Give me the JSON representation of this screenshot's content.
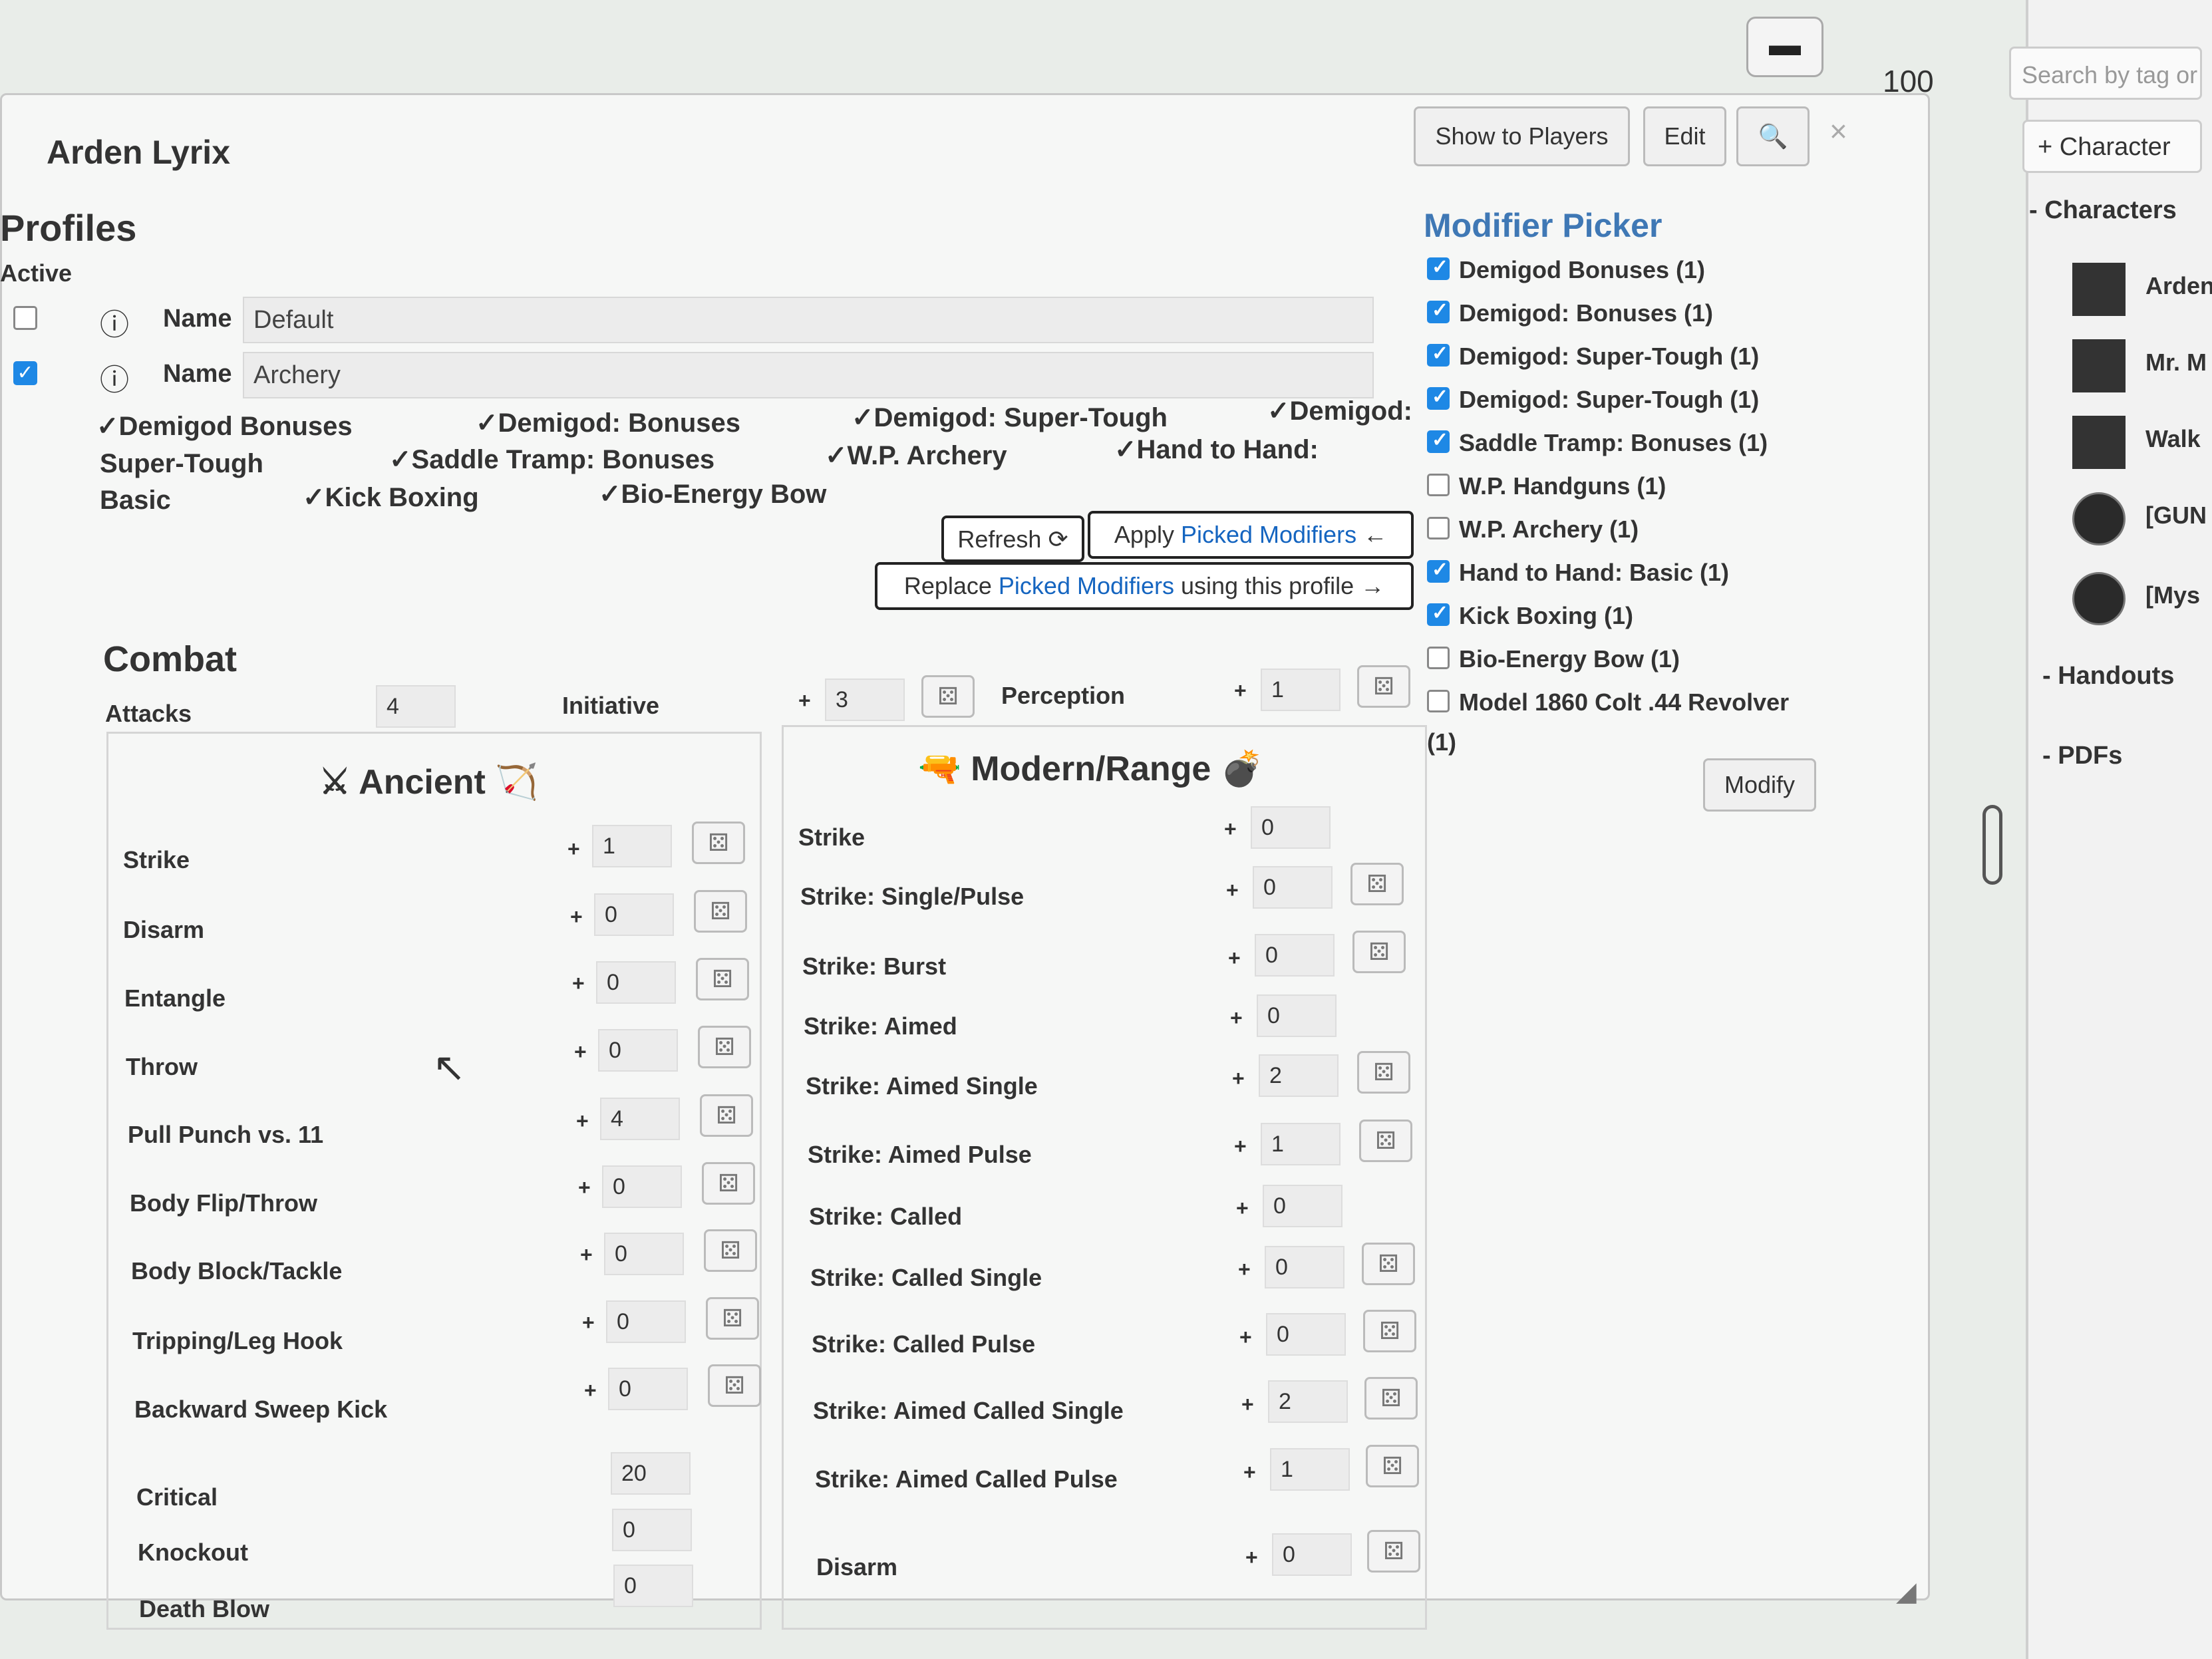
{
  "sidebar": {
    "search_placeholder": "Search by tag or",
    "add_character": "+ Character",
    "folders": {
      "characters": "-  Characters",
      "handouts": "-  Handouts",
      "pdfs": "-  PDFs"
    },
    "roster": [
      "Arden",
      "Mr. M",
      "Walk",
      "[GUN",
      "[Mys"
    ]
  },
  "zoom": {
    "label": "100",
    "plus": "+",
    "minus": "−"
  },
  "dialog": {
    "title": "Arden Lyrix",
    "buttons": {
      "show_to_players": "Show to Players",
      "edit": "Edit",
      "search": "🔍",
      "close": "×"
    }
  },
  "profiles": {
    "heading": "Profiles",
    "active_label": "Active",
    "name_label": "Name",
    "rows": [
      {
        "active": false,
        "name": "Default"
      },
      {
        "active": true,
        "name": "Archery"
      }
    ],
    "applied_modifiers": [
      "✓Demigod Bonuses",
      "✓Demigod: Bonuses",
      "✓Demigod: Super-Tough",
      "✓Demigod:",
      "Super-Tough",
      "✓Saddle Tramp: Bonuses",
      "✓W.P. Archery",
      "✓Hand to Hand:",
      "Basic",
      "✓Kick Boxing",
      "✓Bio-Energy Bow"
    ],
    "refresh_label": "Refresh ⟳",
    "apply_label_prefix": "Apply ",
    "apply_label_hl": "Picked Modifiers",
    "apply_label_suffix": " ←",
    "replace_prefix": "Replace ",
    "replace_hl": "Picked Modifiers",
    "replace_suffix": " using this profile →"
  },
  "combat": {
    "heading": "Combat",
    "attacks_label": "Attacks",
    "attacks_value": "4",
    "initiative_label": "Initiative",
    "initiative_value": "3",
    "perception_label": "Perception",
    "perception_value": "1",
    "plus": "+",
    "roll_icon": "⚄",
    "ancient": {
      "title": "⚔ Ancient 🏹",
      "rows": [
        {
          "label": "Strike",
          "value": "1"
        },
        {
          "label": "Disarm",
          "value": "0"
        },
        {
          "label": "Entangle",
          "value": "0"
        },
        {
          "label": "Throw",
          "value": "0"
        },
        {
          "label": "Pull Punch vs. 11",
          "value": "4"
        },
        {
          "label": "Body Flip/Throw",
          "value": "0"
        },
        {
          "label": "Body Block/Tackle",
          "value": "0"
        },
        {
          "label": "Tripping/Leg Hook",
          "value": "0"
        },
        {
          "label": "Backward Sweep Kick",
          "value": "0"
        }
      ],
      "extra": [
        {
          "label": "Critical",
          "value": "20"
        },
        {
          "label": "Knockout",
          "value": "0"
        },
        {
          "label": "Death Blow",
          "value": "0"
        }
      ]
    },
    "modern": {
      "title": "🔫 Modern/Range 💣",
      "rows": [
        {
          "label": "Strike",
          "value": "0",
          "roll": false
        },
        {
          "label": "Strike: Single/Pulse",
          "value": "0",
          "roll": true
        },
        {
          "label": "Strike: Burst",
          "value": "0",
          "roll": true
        },
        {
          "label": "Strike: Aimed",
          "value": "0",
          "roll": false
        },
        {
          "label": "Strike: Aimed Single",
          "value": "2",
          "roll": true
        },
        {
          "label": "Strike: Aimed Pulse",
          "value": "1",
          "roll": true
        },
        {
          "label": "Strike: Called",
          "value": "0",
          "roll": false
        },
        {
          "label": "Strike: Called Single",
          "value": "0",
          "roll": true
        },
        {
          "label": "Strike: Called Pulse",
          "value": "0",
          "roll": true
        },
        {
          "label": "Strike: Aimed Called Single",
          "value": "2",
          "roll": true
        },
        {
          "label": "Strike: Aimed Called Pulse",
          "value": "1",
          "roll": true
        },
        {
          "label": "Disarm",
          "value": "0",
          "roll": true
        }
      ]
    }
  },
  "modifier_picker": {
    "title": "Modifier Picker",
    "items": [
      {
        "label": "Demigod Bonuses (1)",
        "checked": true
      },
      {
        "label": "Demigod: Bonuses (1)",
        "checked": true
      },
      {
        "label": "Demigod: Super-Tough (1)",
        "checked": true
      },
      {
        "label": "Demigod: Super-Tough (1)",
        "checked": true
      },
      {
        "label": "Saddle Tramp: Bonuses (1)",
        "checked": true
      },
      {
        "label": "W.P. Handguns (1)",
        "checked": false
      },
      {
        "label": "W.P. Archery (1)",
        "checked": false
      },
      {
        "label": "Hand to Hand: Basic (1)",
        "checked": true
      },
      {
        "label": "Kick Boxing (1)",
        "checked": true
      },
      {
        "label": "Bio-Energy Bow (1)",
        "checked": false
      },
      {
        "label": "Model 1860 Colt .44 Revolver",
        "checked": false
      }
    ],
    "overflow_text": "(1)",
    "modify_label": "Modify"
  },
  "colors": {
    "accent": "#1e88e5",
    "picker_title": "#3f78b5",
    "zoom": "#c2185b"
  }
}
